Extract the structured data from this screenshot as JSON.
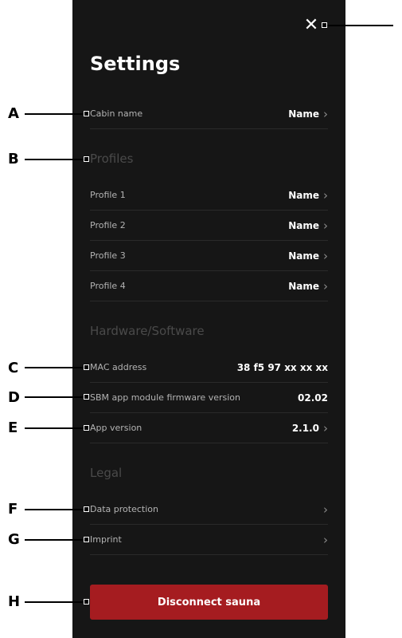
{
  "header": {
    "title": "Settings",
    "close_icon": "close-icon"
  },
  "rows": {
    "cabin": {
      "label": "Cabin name",
      "value": "Name"
    },
    "profile1": {
      "label": "Profile 1",
      "value": "Name"
    },
    "profile2": {
      "label": "Profile 2",
      "value": "Name"
    },
    "profile3": {
      "label": "Profile 3",
      "value": "Name"
    },
    "profile4": {
      "label": "Profile 4",
      "value": "Name"
    },
    "mac": {
      "label": "MAC address",
      "value": "38 f5 97 xx xx xx"
    },
    "firmware": {
      "label": "SBM app module firmware version",
      "value": "02.02"
    },
    "app_version": {
      "label": "App version",
      "value": "2.1.0"
    },
    "data_protection": {
      "label": "Data protection"
    },
    "imprint": {
      "label": "Imprint"
    }
  },
  "sections": {
    "profiles": "Profiles",
    "hardware": "Hardware/Software",
    "legal": "Legal"
  },
  "disconnect_label": "Disconnect sauna",
  "callouts": {
    "a": "A",
    "b": "B",
    "c": "C",
    "d": "D",
    "e": "E",
    "f": "F",
    "g": "G",
    "h": "H"
  },
  "colors": {
    "panel_bg": "#161616",
    "accent_red": "#a51c20",
    "section_gray": "#4a4a4a"
  }
}
